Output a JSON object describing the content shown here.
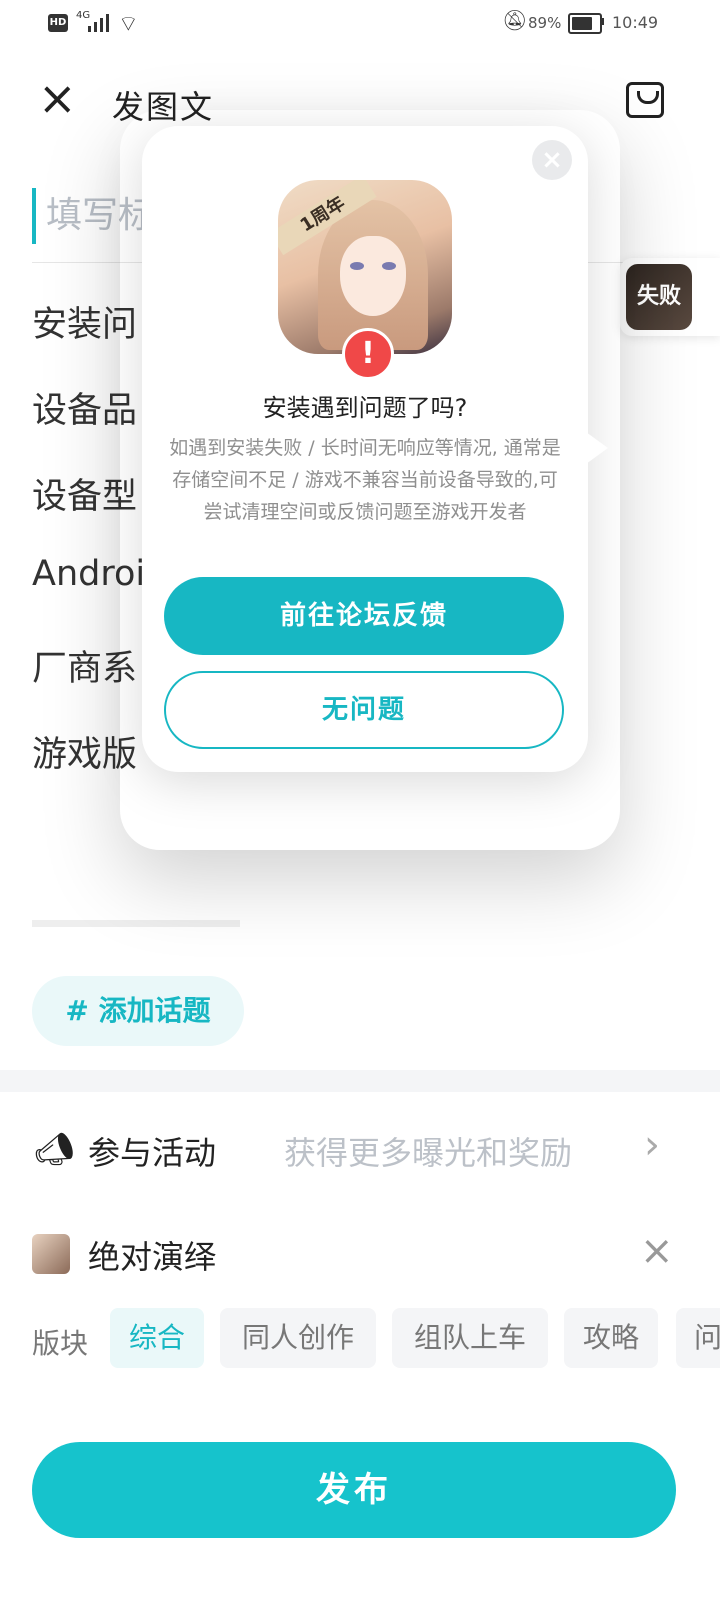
{
  "status_bar": {
    "hd": "HD",
    "network": "4G",
    "battery_percent": "89%",
    "battery_level": 0.89,
    "time": "10:49"
  },
  "top_bar": {
    "title": "发图文",
    "close_icon": "close-icon",
    "draft_icon": "draft-box-icon"
  },
  "form": {
    "title_placeholder": "填写标",
    "lines": [
      "安装问",
      "设备品",
      "设备型",
      "Androi",
      "厂商系",
      "游戏版"
    ]
  },
  "side_fab": {
    "label": "失败"
  },
  "topic": {
    "label": "# 添加话题"
  },
  "activity": {
    "label": "参与活动",
    "hint": "获得更多曝光和奖励",
    "icon": "megaphone-icon"
  },
  "game": {
    "name": "绝对演绎",
    "close_icon": "close-icon"
  },
  "boards": {
    "label": "版块",
    "chips": [
      {
        "label": "综合",
        "active": true
      },
      {
        "label": "同人创作",
        "active": false
      },
      {
        "label": "组队上车",
        "active": false
      },
      {
        "label": "攻略",
        "active": false
      },
      {
        "label": "问",
        "active": false
      }
    ]
  },
  "publish": {
    "label": "发布"
  },
  "popup": {
    "icon_banner": "1周年",
    "title": "安装遇到问题了吗?",
    "body": "如遇到安装失败 / 长时间无响应等情况, 通常是存储空间不足 / 游戏不兼容当前设备导致的,可尝试清理空间或反馈问题至游戏开发者",
    "primary_button": "前往论坛反馈",
    "secondary_button": "无问题",
    "warning_icon": "warning-icon"
  }
}
